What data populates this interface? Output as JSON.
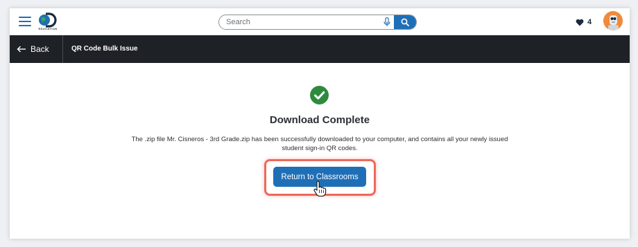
{
  "topbar": {
    "logo_text": "EDUCATION",
    "search": {
      "placeholder": "Search",
      "value": ""
    },
    "favorites_count": "4"
  },
  "subbar": {
    "back_label": "Back",
    "page_title": "QR Code Bulk Issue"
  },
  "main": {
    "heading": "Download Complete",
    "message": "The .zip file Mr. Cisneros - 3rd Grade.zip has been successfully downloaded to your computer, and contains all your newly issued student sign-in QR codes.",
    "return_button_label": "Return to Classrooms"
  },
  "colors": {
    "brand_blue": "#1f6fb7",
    "subbar_bg": "#1e2126",
    "success_green": "#2e8b3e",
    "highlight_border": "#ea6a5c",
    "avatar_orange": "#ef8a3c"
  },
  "icons": [
    "hamburger-menu-icon",
    "discovery-education-logo",
    "microphone-icon",
    "search-icon",
    "heart-icon",
    "user-avatar",
    "back-arrow-icon",
    "check-circle-icon",
    "pointer-hand-cursor"
  ]
}
